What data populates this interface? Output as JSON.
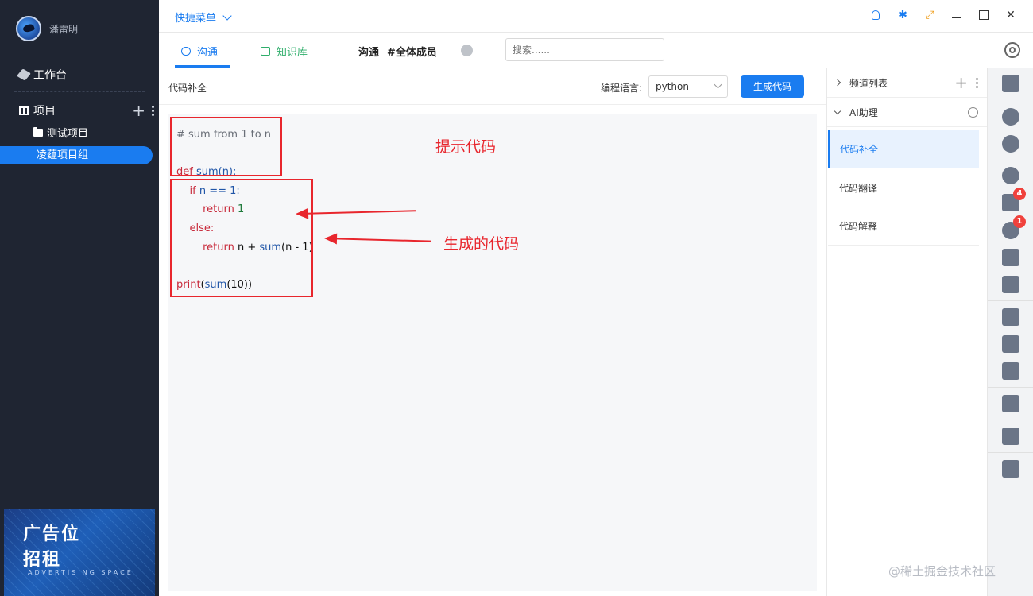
{
  "user": {
    "name": "潘雷明"
  },
  "sidebar": {
    "workbench": "工作台",
    "projects": "项目",
    "sub_items": [
      "测试项目",
      "凌蕴项目组"
    ],
    "ad": {
      "line1": "广告位",
      "line2": "招租",
      "line3": "ADVERTISING SPACE"
    }
  },
  "topbar": {
    "quick_menu": "快捷菜单",
    "icons": [
      "bulb-icon",
      "bug-icon",
      "connect-icon",
      "minimize-icon",
      "maximize-icon",
      "close-icon"
    ]
  },
  "tabs": {
    "comms": "沟通",
    "knowledge": "知识库",
    "channel_prefix": "沟通",
    "channel_name": "#全体成员",
    "search_placeholder": "搜索......"
  },
  "main": {
    "title": "代码补全",
    "lang_label": "编程语言:",
    "lang_value": "python",
    "generate_button": "生成代码",
    "code": {
      "comment": "# sum from 1 to n",
      "def_kw": "def",
      "def_sig_fn": "sum",
      "def_sig_rest": "(n):",
      "if_kw": "if",
      "if_cond": " n == 1:",
      "return_kw": "return",
      "return_one": " 1",
      "else_kw": "else:",
      "return_expr_a": " n + ",
      "return_expr_fn": "sum",
      "return_expr_b": "(n - 1)",
      "print_kw": "print",
      "print_open": "(",
      "print_fn": "sum",
      "print_args": "(10))"
    },
    "annotations": {
      "hint": "提示代码",
      "generated": "生成的代码"
    }
  },
  "right_panel": {
    "channel_list": "频道列表",
    "ai_assistant": "AI助理",
    "ai_items": [
      "代码补全",
      "代码翻译",
      "代码解释"
    ]
  },
  "iconbar": {
    "badges": [
      "4",
      "1"
    ]
  },
  "watermark": "@稀土掘金技术社区",
  "colors": {
    "accent": "#1a7cf0",
    "sidebar_bg": "#1f2532",
    "annotation_red": "#e8262d",
    "badge_red": "#f0413c"
  }
}
